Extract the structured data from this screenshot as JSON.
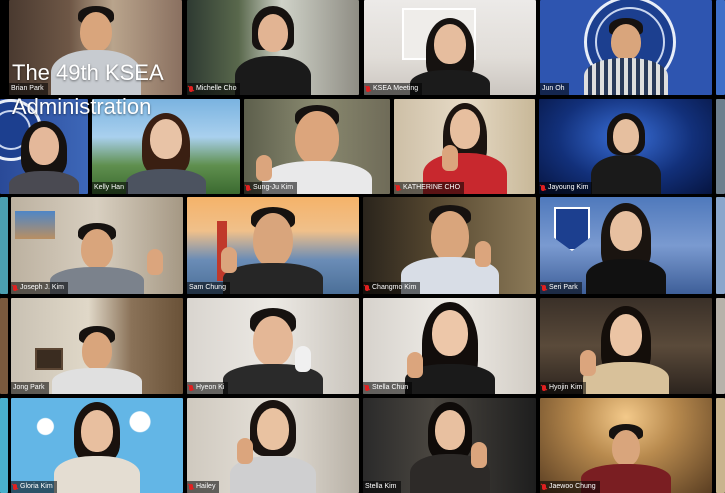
{
  "overlay": {
    "title_line1": "The 49th KSEA",
    "title_line2": "Administration"
  },
  "participants": [
    {
      "name": "Brian Park",
      "muted": false
    },
    {
      "name": "Michelle Cho",
      "muted": true
    },
    {
      "name": "",
      "muted": false
    },
    {
      "name": "KSEA Meeting",
      "muted": true
    },
    {
      "name": "Jun Oh",
      "muted": false
    },
    {
      "name": "",
      "muted": false
    },
    {
      "name": "Kelly Han",
      "muted": false
    },
    {
      "name": "Sung-Ju Kim",
      "muted": true
    },
    {
      "name": "KATHERINE CHO",
      "muted": true
    },
    {
      "name": "Jayoung Kim",
      "muted": true
    },
    {
      "name": "Joseph J. Kim",
      "muted": true
    },
    {
      "name": "Sam Chung",
      "muted": false
    },
    {
      "name": "Changmo Kim",
      "muted": true
    },
    {
      "name": "Seri Park",
      "muted": true
    },
    {
      "name": "Jong Park",
      "muted": false
    },
    {
      "name": "Hyeon Ki",
      "muted": true
    },
    {
      "name": "Stella Chun",
      "muted": true
    },
    {
      "name": "Hyojin Kim",
      "muted": true
    },
    {
      "name": "Gloria Kim",
      "muted": true
    },
    {
      "name": "Hailey",
      "muted": true
    },
    {
      "name": "Stella Kim",
      "muted": false
    },
    {
      "name": "Jaewoo Chung",
      "muted": true
    }
  ],
  "colors": {
    "mic_muted": "#e02020",
    "namebar_bg": "rgba(0,0,0,0.55)"
  }
}
